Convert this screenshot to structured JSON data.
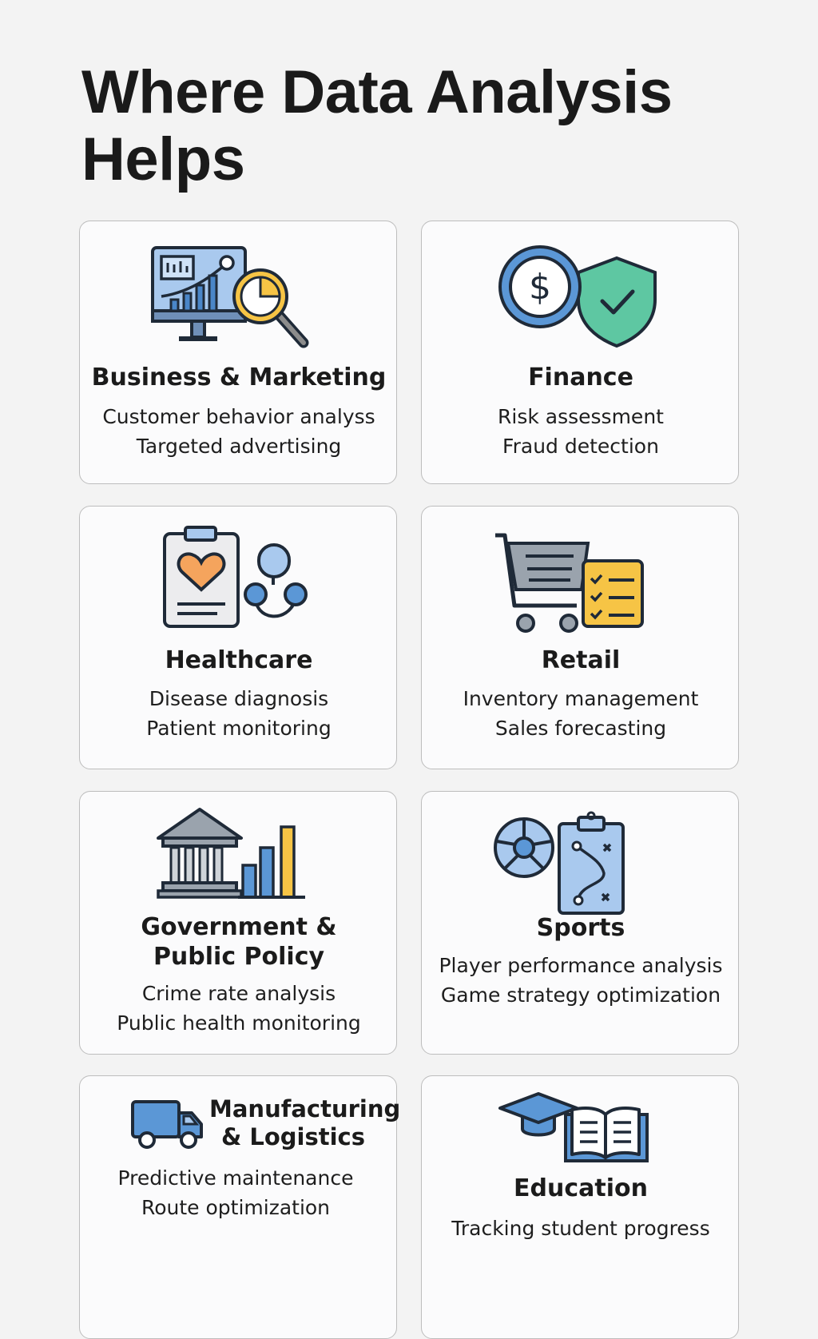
{
  "page": {
    "title_line1": "Where Data Analysis",
    "title_line2": "Helps"
  },
  "colors": {
    "blue": "#5b97d6",
    "light_blue": "#a9c9ee",
    "yellow": "#f6c445",
    "green": "#5ec7a2",
    "orange": "#f5a45d",
    "gray": "#8c8c8c",
    "outline": "#1f2a38"
  },
  "cards": [
    {
      "icon": "monitor-analytics-magnifier-icon",
      "title": "Business & Marketing",
      "items": [
        "Customer behavior analyss",
        "Targeted advertising"
      ]
    },
    {
      "icon": "dollar-coin-shield-check-icon",
      "title": "Finance",
      "items": [
        "Risk assessment",
        "Fraud detection"
      ]
    },
    {
      "icon": "clipboard-heart-stethoscope-icon",
      "title": "Healthcare",
      "items": [
        "Disease diagnosis",
        "Patient monitoring"
      ]
    },
    {
      "icon": "shopping-cart-checklist-icon",
      "title": "Retail",
      "items": [
        "Inventory management",
        "Sales forecasting"
      ]
    },
    {
      "icon": "government-building-bar-chart-icon",
      "title_line1": "Government &",
      "title_line2": "Public Policy",
      "items": [
        "Crime rate analysis",
        "Public health monitoring"
      ]
    },
    {
      "icon": "ball-strategy-clipboard-icon",
      "title": "Sports",
      "items": [
        "Player performance analysis",
        "Game strategy optimization"
      ]
    },
    {
      "icon": "delivery-truck-icon",
      "title_line1": "Manufacturing",
      "title_line2": "& Logistics",
      "items": [
        "Predictive maintenance",
        "Route optimization"
      ]
    },
    {
      "icon": "graduation-cap-book-icon",
      "title": "Education",
      "items": [
        "Tracking student progress"
      ]
    }
  ]
}
